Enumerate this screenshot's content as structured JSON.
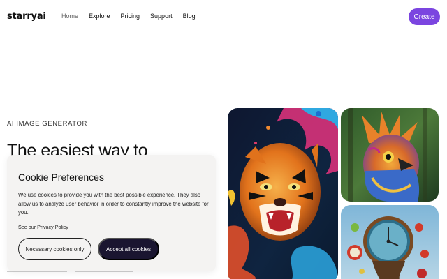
{
  "header": {
    "logo": "starryai",
    "nav": [
      {
        "label": "Home"
      },
      {
        "label": "Explore"
      },
      {
        "label": "Pricing"
      },
      {
        "label": "Support"
      },
      {
        "label": "Blog"
      }
    ],
    "create_label": "Create"
  },
  "hero": {
    "eyebrow": "AI IMAGE GENERATOR",
    "title": "The easiest way to"
  },
  "cookie": {
    "title": "Cookie Preferences",
    "body": "We use cookies to provide you with the best possible experience. They also allow us to analyze user behavior in order to constantly improve the website for you.",
    "link": "See our Privacy Policy",
    "necessary_label": "Necessary cookies only",
    "accept_label": "Accept all cookies"
  },
  "colors": {
    "accent": "#7b45e0",
    "dark_button": "#1a1530",
    "modal_bg": "#f4f3f2"
  },
  "images": {
    "tiger": "tiger-artwork-image",
    "bird": "bird-artwork-image",
    "clock": "clock-artwork-image"
  }
}
